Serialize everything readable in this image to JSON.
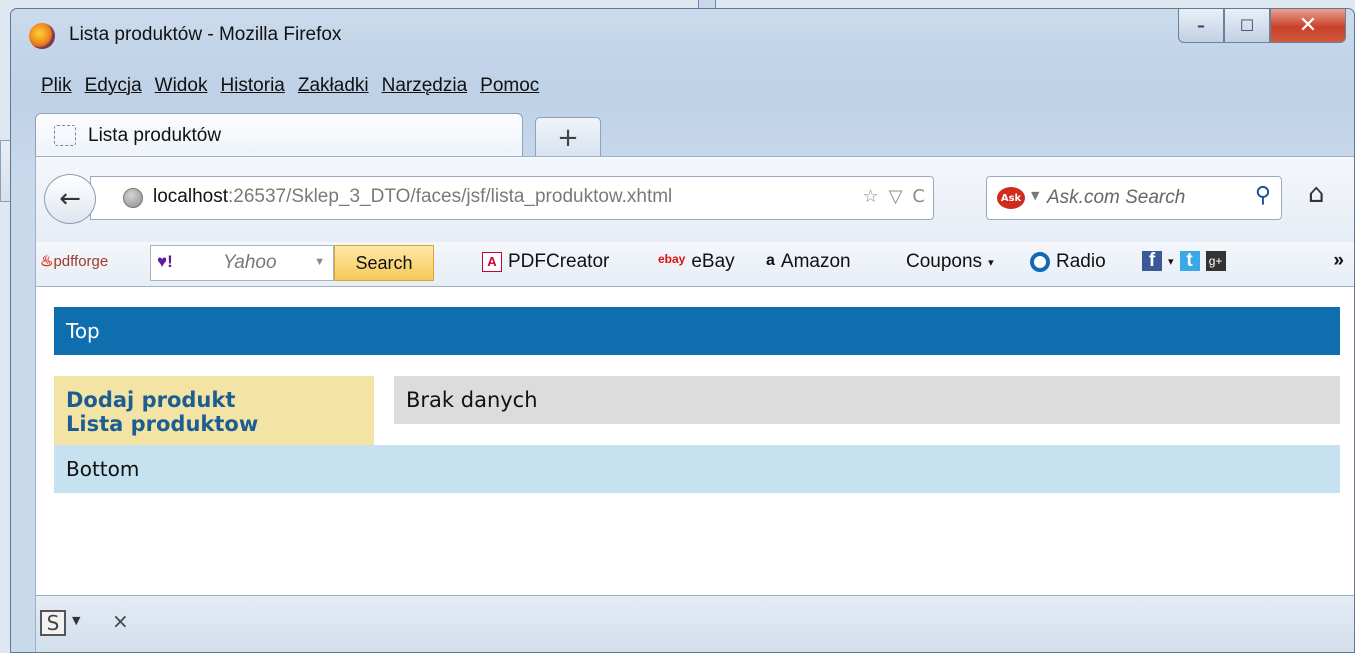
{
  "window": {
    "title": "Lista produktów - Mozilla Firefox",
    "controls": {
      "minimize": "–",
      "maximize": "☐",
      "close": "✕"
    }
  },
  "menu": [
    {
      "label": "Plik"
    },
    {
      "label": "Edycja"
    },
    {
      "label": "Widok"
    },
    {
      "label": "Historia"
    },
    {
      "label": "Zakładki"
    },
    {
      "label": "Narzędzia"
    },
    {
      "label": "Pomoc"
    }
  ],
  "tab": {
    "label": "Lista produktów",
    "new_tab": "+"
  },
  "nav": {
    "back": "←",
    "url_host": "localhost",
    "url_rest": ":26537/Sklep_3_DTO/faces/jsf/lista_produktow.xhtml",
    "url_icons": [
      "☆",
      "▽",
      "C"
    ],
    "search_placeholder": "Ask.com Search",
    "search_logo": "Ask",
    "search_go": "⚲",
    "home": "⌂"
  },
  "toolbar": {
    "pdfforge": "pdfforge",
    "yahoo_logo": "♥!",
    "yahoo_text": "Yahoo",
    "search_button": "Search",
    "items": [
      {
        "label": "PDFCreator",
        "icon": "pdf-icon"
      },
      {
        "label": "eBay",
        "icon": "ebay-icon"
      },
      {
        "label": "Amazon",
        "icon": "amazon-icon"
      },
      {
        "label": "Coupons",
        "icon": "coupons-dropdown"
      },
      {
        "label": "Radio",
        "icon": "radio-icon"
      }
    ],
    "overflow": "»"
  },
  "page": {
    "top": "Top",
    "left_links": [
      "Dodaj produkt",
      "Lista produktow"
    ],
    "main": "Brak danych",
    "bottom": "Bottom"
  },
  "status": {
    "s_icon": "S",
    "close": "×"
  }
}
